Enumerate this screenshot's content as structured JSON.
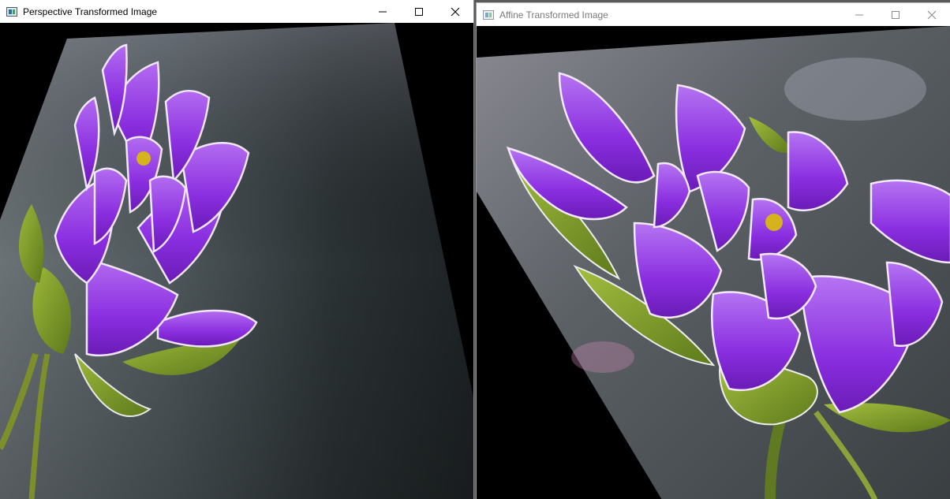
{
  "windows": [
    {
      "title": "Perspective Transformed Image",
      "icon": "app-window-icon",
      "controls": [
        "minimize-icon",
        "maximize-icon",
        "close-icon"
      ]
    },
    {
      "title": "Affine Transformed Image",
      "icon": "app-window-icon",
      "controls": [
        "minimize-icon",
        "maximize-icon",
        "close-icon"
      ]
    }
  ],
  "colors": {
    "petal": "#8a2ee0",
    "petal_light": "#c48af5",
    "leaf": "#7c9a2a",
    "background_gray": "#4d5558"
  }
}
